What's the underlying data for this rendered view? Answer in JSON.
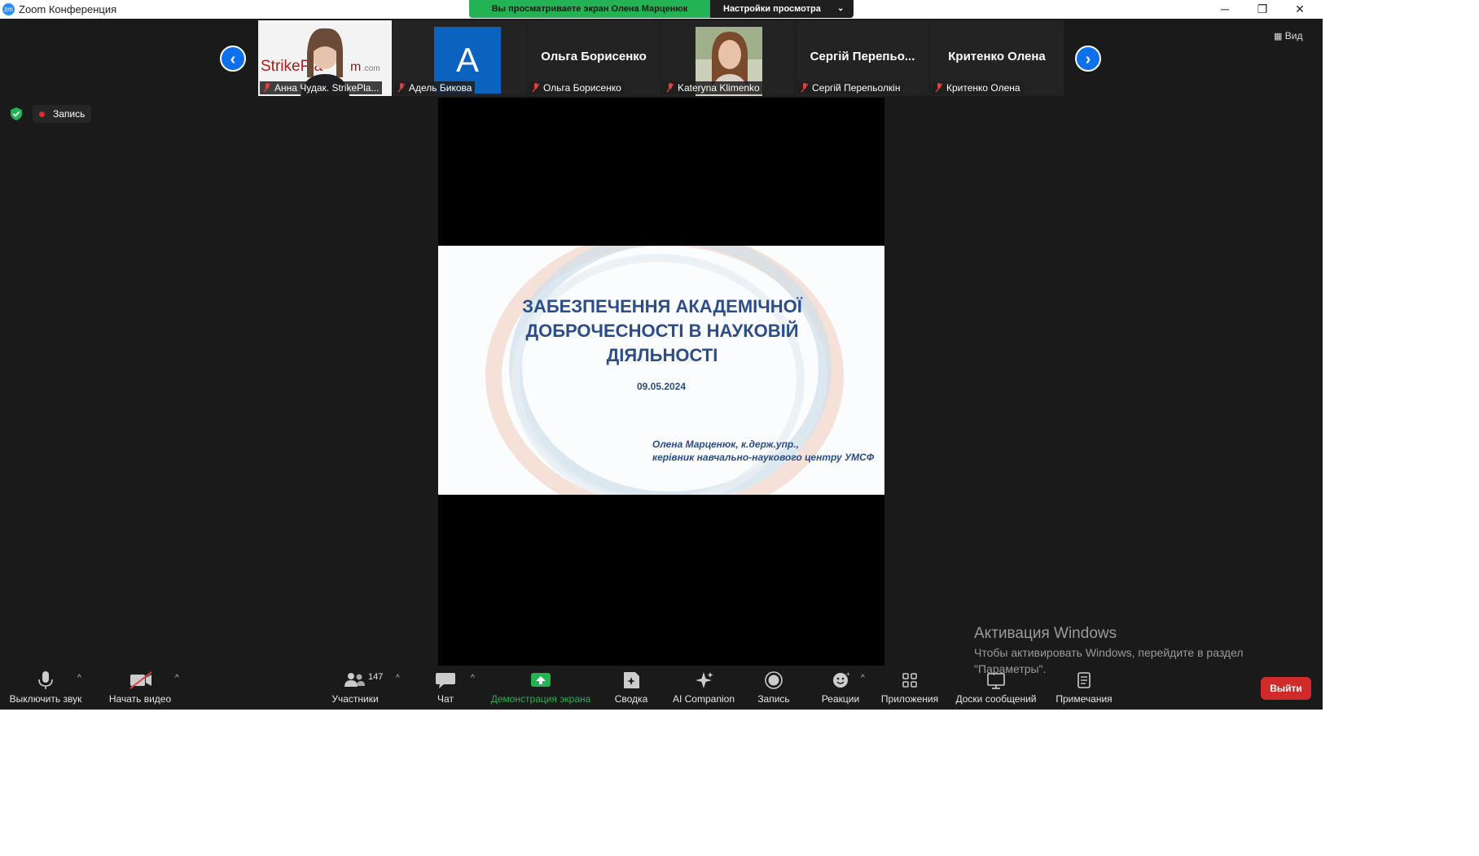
{
  "app": {
    "title": "Zoom Конференция",
    "logo_text": "zm",
    "share_banner": "Вы просматриваете экран Олена Марценюк",
    "view_settings": "Настройки просмотра",
    "view_button": "Вид"
  },
  "participants": [
    {
      "label": "Анна Чудак. StrikePla...",
      "muted": true,
      "video": "photo"
    },
    {
      "label": "Адель Бикова",
      "muted": true,
      "avatar": "A"
    },
    {
      "label": "Ольга Борисенко",
      "muted": true,
      "name_big": "Ольга Борисенко"
    },
    {
      "label": "Kateryna Klimenko",
      "muted": true,
      "video": "photo"
    },
    {
      "label": "Сергій Перепьолкін",
      "muted": true,
      "name_big": "Сергій  Перепьо..."
    },
    {
      "label": "Критенко Олена",
      "muted": true,
      "name_big": "Критенко Олена"
    }
  ],
  "status": {
    "recording": "Запись"
  },
  "slide": {
    "title_lines": [
      "ЗАБЕЗПЕЧЕННЯ АКАДЕМІЧНОЇ",
      "ДОБРОЧЕСНОСТІ В НАУКОВІЙ",
      "ДІЯЛЬНОСТІ"
    ],
    "date": "09.05.2024",
    "author_line1": "Олена Марценюк, к.держ.упр.,",
    "author_line2": "керівник навчально-наукового центру УМСФ"
  },
  "watermark": {
    "title": "Активация Windows",
    "text": "Чтобы активировать Windows, перейдите в раздел \"Параметры\"."
  },
  "toolbar": {
    "mute": "Выключить звук",
    "video": "Начать видео",
    "participants": "Участники",
    "participants_count": "147",
    "chat": "Чат",
    "share": "Демонстрация экрана",
    "summary": "Сводка",
    "ai": "AI Companion",
    "record": "Запись",
    "reactions": "Реакции",
    "apps": "Приложения",
    "whiteboards": "Доски сообщений",
    "notes": "Примечания",
    "leave": "Выйти"
  },
  "colors": {
    "accent": "#0e71eb",
    "share_green": "#23b254",
    "leave_red": "#d02a2a",
    "slide_text": "#2b4d8c"
  }
}
